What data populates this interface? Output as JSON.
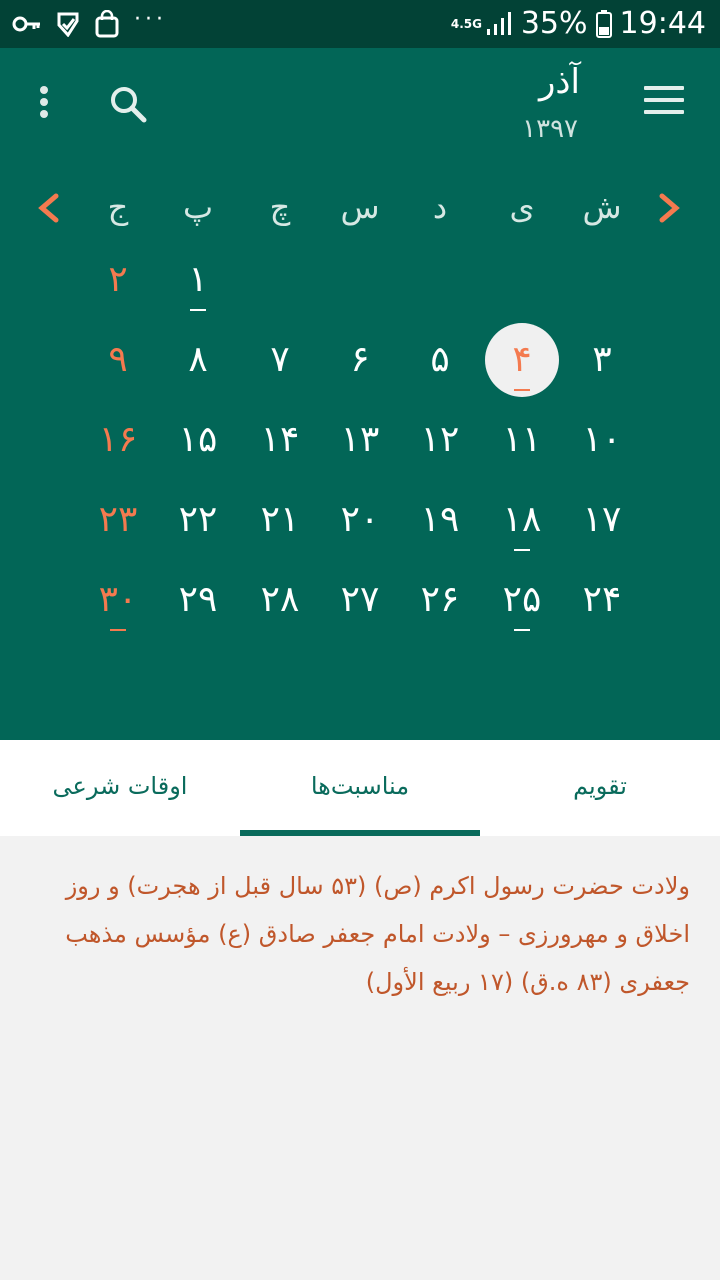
{
  "status_bar": {
    "network": "4.5G",
    "battery": "35%",
    "time": "19:44",
    "icons": [
      "key-icon",
      "check-icon",
      "bag-icon",
      "more-notifications-icon",
      "signal-icon",
      "battery-icon"
    ]
  },
  "header": {
    "month": "آذر",
    "year": "۱۳۹۷",
    "icons": [
      "menu-icon",
      "search-icon",
      "more-vert-icon",
      "chevron-right-icon",
      "chevron-left-icon"
    ]
  },
  "weekdays": [
    "ش",
    "ی",
    "د",
    "س",
    "چ",
    "پ",
    "ج"
  ],
  "weeks": [
    [
      "",
      "",
      "",
      "",
      "",
      "۱",
      "۲"
    ],
    [
      "۳",
      "۴",
      "۵",
      "۶",
      "۷",
      "۸",
      "۹"
    ],
    [
      "۱۰",
      "۱۱",
      "۱۲",
      "۱۳",
      "۱۴",
      "۱۵",
      "۱۶"
    ],
    [
      "۱۷",
      "۱۸",
      "۱۹",
      "۲۰",
      "۲۱",
      "۲۲",
      "۲۳"
    ],
    [
      "۲۴",
      "۲۵",
      "۲۶",
      "۲۷",
      "۲۸",
      "۲۹",
      "۳۰"
    ]
  ],
  "today": "۴",
  "marked_days": [
    "۱",
    "۴",
    "۱۸",
    "۲۵",
    "۳۰"
  ],
  "tabs": [
    "تقویم",
    "مناسبت‌ها",
    "اوقات شرعی"
  ],
  "active_tab": "مناسبت‌ها",
  "event_text": "ولادت حضرت رسول اکرم (ص) (۵۳ سال قبل از هجرت) و روز اخلاق و مهرورزی – ولادت امام جعفر صادق (ع) مؤسس مذهب جعفری (۸۳ ه.ق) (۱۷ ربیع الأول)",
  "colors": {
    "primary": "#026657",
    "status_bar": "#024236",
    "accent": "#f47a4f",
    "event_text": "#c0572b"
  }
}
